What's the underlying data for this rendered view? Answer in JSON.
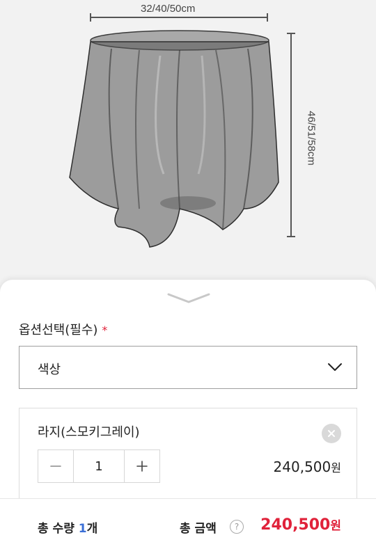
{
  "product": {
    "image_alt": "transparent ghost table",
    "dim_width": "32/40/50cm",
    "dim_height": "46/51/58cm"
  },
  "option": {
    "title": "옵션선택(필수)",
    "required_mark": "*",
    "select_value": "색상"
  },
  "item": {
    "name": "라지(스모키그레이)",
    "quantity": "1",
    "price": "240,500",
    "price_unit": "원"
  },
  "total": {
    "qty_label": "총 수량",
    "qty_value": "1",
    "qty_unit": "개",
    "amount_label": "총 금액",
    "help": "?",
    "amount": "240,500",
    "amount_unit": "원"
  },
  "colors": {
    "accent_red": "#e0223a",
    "accent_blue": "#3b6fd6"
  }
}
